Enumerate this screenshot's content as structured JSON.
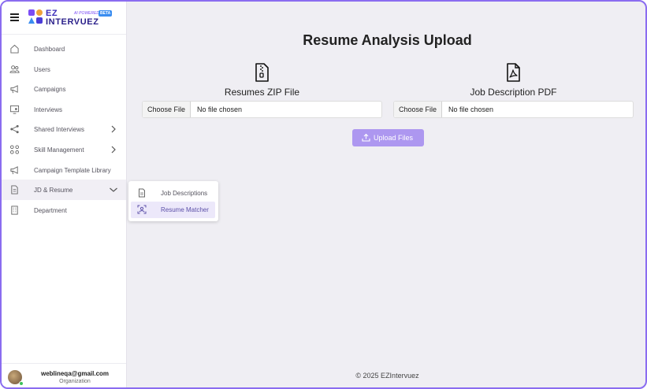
{
  "brand": {
    "prefix": "EZ",
    "name": "INTERVUEZ",
    "tagline": "AI POWERED",
    "badge": "BETA"
  },
  "sidebar": {
    "items": [
      {
        "label": "Dashboard",
        "icon": "home-icon"
      },
      {
        "label": "Users",
        "icon": "users-icon"
      },
      {
        "label": "Campaigns",
        "icon": "megaphone-icon"
      },
      {
        "label": "Interviews",
        "icon": "monitor-user-icon"
      },
      {
        "label": "Shared Interviews",
        "icon": "share-icon",
        "chevron": "chevron-right-icon"
      },
      {
        "label": "Skill Management",
        "icon": "grid-circles-icon",
        "chevron": "chevron-right-icon"
      },
      {
        "label": "Campaign Template Library",
        "icon": "megaphone-icon"
      },
      {
        "label": "JD & Resume",
        "icon": "document-icon",
        "chevron": "chevron-down-icon",
        "active": true
      },
      {
        "label": "Department",
        "icon": "building-icon"
      }
    ],
    "submenu": [
      {
        "label": "Job Descriptions",
        "icon": "document-icon"
      },
      {
        "label": "Resume Matcher",
        "icon": "user-scan-icon",
        "selected": true
      }
    ]
  },
  "user": {
    "email": "weblineqa@gmail.com",
    "role": "Organization"
  },
  "main": {
    "title": "Resume Analysis Upload",
    "uploads": [
      {
        "label": "Resumes ZIP File",
        "icon": "zip-file-icon",
        "button": "Choose File",
        "status": "No file chosen"
      },
      {
        "label": "Job Description PDF",
        "icon": "pdf-file-icon",
        "button": "Choose File",
        "status": "No file chosen"
      }
    ],
    "upload_button": "Upload Files",
    "footer": "© 2025 EZIntervuez"
  },
  "colors": {
    "accent": "#8a6cf0",
    "upload_button": "#ad97f0",
    "background": "#efeef3"
  }
}
